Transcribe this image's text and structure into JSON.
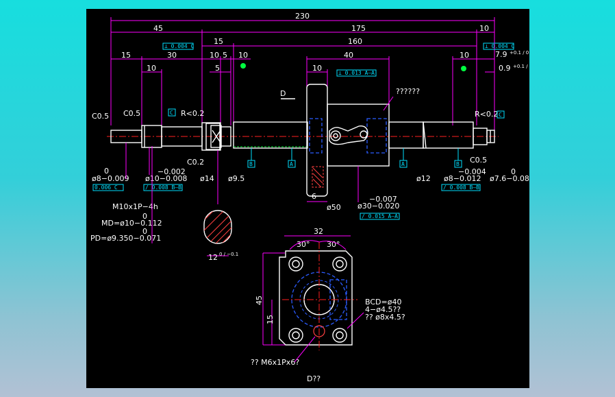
{
  "drawing": {
    "dimensions_top": {
      "overall": "230",
      "left_end": "45",
      "middle": "175",
      "right_end": "10",
      "d15": "15",
      "d160": "160",
      "left15": "15",
      "left30": "30",
      "left10": "10",
      "d10a": "10",
      "d5a": "5",
      "d10b": "10",
      "d5b": "5",
      "d40": "40",
      "d10c": "10",
      "d10r": "10",
      "r79": "7.9",
      "r79tol": "+0.1 / 0",
      "r09": "0.9",
      "r09tol": "+0.1 / 0"
    },
    "tolerance_frames": {
      "perp_left": "⊥ 0.004 C",
      "perp_right": "⊥ 0.004 C",
      "perp_nut": "⊥ 0.013 A–A",
      "run_left": "0.006 C",
      "run_lb": "/ 0.008 B–B",
      "run_rb": "/ 0.008 B–B",
      "run_nut": "/ 0.015 A–A"
    },
    "labels": {
      "c05_left": "C0.5",
      "c05_b": "C0.5",
      "r02_left": "R<0.2",
      "c02": "C0.2",
      "d_label": "D",
      "nut_note": "??????",
      "r02_right": "R<0.2",
      "c05_right": "C0.5",
      "datum_c": "C",
      "datum_b": "B",
      "datum_a": "A"
    },
    "diameters": {
      "d8_top": "0",
      "d8": "ø8−0.009",
      "d10_top": "−0.002",
      "d10": "ø10−0.008",
      "d14": "ø14",
      "d95": "ø9.5",
      "d50": "ø50",
      "nut6": "6",
      "d30_top": "−0.007",
      "d30": "ø30−0.020",
      "d12": "ø12",
      "d8r_top": "−0.004",
      "d8r": "ø8−0.012",
      "d76_top": "0",
      "d76": "ø7.6−0.08"
    },
    "thread_notes": {
      "thread": "M10x1P−4h",
      "md_top": "0",
      "md": "MD=ø10−0.112",
      "pd_top": "0",
      "pd": "PD=ø9.350−0.071"
    },
    "section": {
      "width": "12−0.1",
      "width_main": "12",
      "width_tol": "0 / −0.1"
    },
    "flange_view": {
      "width32": "32",
      "angle_left": "30°",
      "angle_right": "30°",
      "height45": "45",
      "height15": "15",
      "bcd": "BCD=ø40",
      "holes": "4−ø4.5??",
      "cbore": "?? ø8x4.5?",
      "tap": "?? M6x1Px6?",
      "view_label": "D??"
    },
    "colors": {
      "background": "#000000",
      "dimension": "#ff00ff",
      "outline": "#ffffff",
      "centerline": "#ff2020",
      "hidden": "#2b5cff",
      "text_green": "#00ff40",
      "text_cyan": "#00e0ff"
    }
  }
}
